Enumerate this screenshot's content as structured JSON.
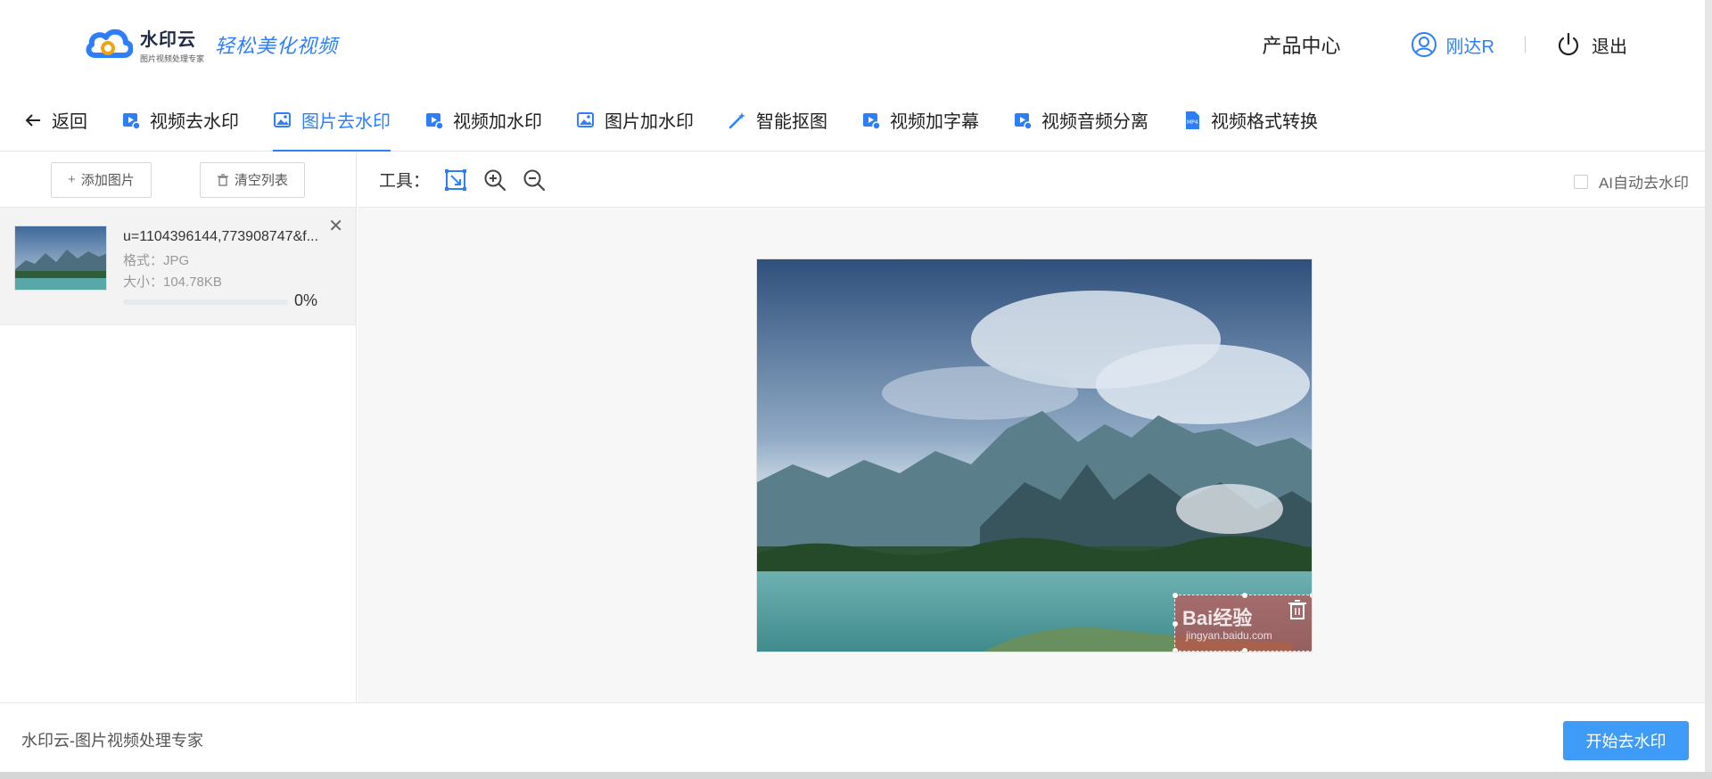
{
  "header": {
    "logo_name": "水印云",
    "logo_sub": "图片视频处理专家",
    "logo_slogan": "轻松美化视频",
    "product_center": "产品中心",
    "username": "刚达R",
    "logout": "退出"
  },
  "nav": {
    "back": "返回",
    "items": [
      {
        "label": "视频去水印",
        "icon": "video-icon"
      },
      {
        "label": "图片去水印",
        "icon": "image-icon",
        "active": true
      },
      {
        "label": "视频加水印",
        "icon": "video-icon"
      },
      {
        "label": "图片加水印",
        "icon": "image-icon"
      },
      {
        "label": "智能抠图",
        "icon": "magic-wand-icon"
      },
      {
        "label": "视频加字幕",
        "icon": "video-icon"
      },
      {
        "label": "视频音频分离",
        "icon": "video-icon"
      },
      {
        "label": "视频格式转换",
        "icon": "mp4-file-icon"
      }
    ]
  },
  "left": {
    "add_image": "添加图片",
    "clear_list": "清空列表",
    "file": {
      "name": "u=1104396144,773908747&f...",
      "format": "格式：JPG",
      "size": "大小：104.78KB",
      "progress_text": "0%",
      "progress": 0
    }
  },
  "toolbar": {
    "label": "工具：",
    "ai_auto": "AI自动去水印"
  },
  "watermark": {
    "text": "Bai经验",
    "sub": "jingyan.baidu.com"
  },
  "footer": {
    "text": "水印云-图片视频处理专家",
    "start_button": "开始去水印"
  },
  "colors": {
    "accent": "#2d7ff9",
    "start_button": "#3f9bf8"
  }
}
